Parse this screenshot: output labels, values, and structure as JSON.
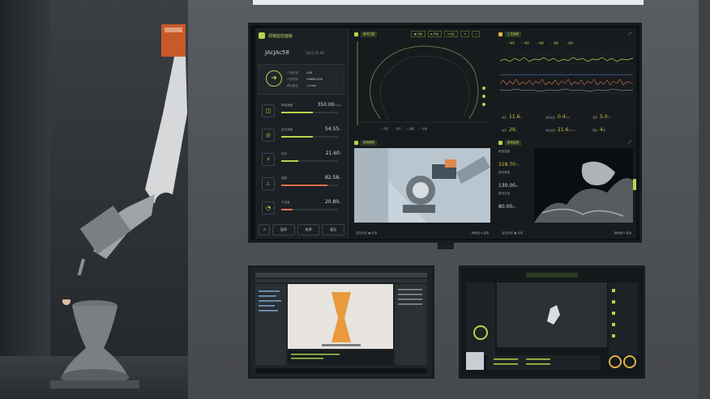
{
  "main_screen": {
    "left_panel": {
      "title": "焊接监控面板",
      "part_id": "JAcJAc58",
      "date": "2022.05.06",
      "info": [
        {
          "label": "产品型号",
          "value": "LH8"
        },
        {
          "label": "产品材料",
          "value": "H08Mn2SiA"
        },
        {
          "label": "焊丝直径",
          "value": "1.2mm"
        }
      ],
      "metrics": [
        {
          "label": "焊接速度",
          "value": "350.00",
          "unit": "mm/s",
          "fill": 0.55,
          "color": "#b8d24a"
        },
        {
          "label": "送丝速度",
          "value": "54.55",
          "unit": "%",
          "fill": 0.55,
          "color": "#b8d24a"
        },
        {
          "label": "电流",
          "value": "21.60",
          "unit": "A",
          "fill": 0.3,
          "color": "#b8d24a"
        },
        {
          "label": "温度",
          "value": "82.58",
          "unit": "%",
          "fill": 0.82,
          "color": "#e0704a"
        },
        {
          "label": "气流量",
          "value": "20.80",
          "unit": "%",
          "fill": 0.2,
          "color": "#e0704a"
        }
      ],
      "buttons": [
        "↺",
        "暂停",
        "急停",
        "复位"
      ]
    },
    "scan_panel": {
      "title": "激光扫描",
      "buttons": [
        "● 扫描",
        "▶ 开始",
        "⊗ 停止"
      ],
      "legend": [
        "— 轮廓",
        "— 层高",
        "— 偏差",
        "— 基准"
      ]
    },
    "process_panel": {
      "title": "工艺曲线",
      "legend": [
        "— 电流",
        "— 电压",
        "— 速度",
        "— 温度",
        "— 送丝"
      ],
      "stats": [
        {
          "label": "电压",
          "value": "11.6",
          "unit": "V"
        },
        {
          "label": "送丝速度",
          "value": "0.4",
          "unit": "m/s"
        },
        {
          "label": "温度",
          "value": "5.0",
          "unit": "°C"
        },
        {
          "label": "电流",
          "value": "29",
          "unit": "A"
        },
        {
          "label": "焊接速度",
          "value": "21.6",
          "unit": "mm/s"
        },
        {
          "label": "层数",
          "value": "4",
          "unit": "层"
        }
      ]
    },
    "video_panel": {
      "title": "现场视频",
      "footer_left": "监控状态 ● 在线",
      "footer_right": "清晰度 ▾ 高清"
    },
    "thermal_panel": {
      "title": "熔池监测",
      "values": [
        {
          "label": "熔池温度",
          "value": "318.70",
          "unit": "°C"
        },
        {
          "label": "熔池宽度",
          "value": "130.00",
          "unit": "m"
        },
        {
          "label": "熔池长度",
          "value": "80.00",
          "unit": "m"
        }
      ],
      "footer_left": "监控状态 ● 在线",
      "footer_right": "清晰度 ▾ 高清"
    }
  },
  "colors": {
    "accent": "#b8d24a",
    "warn": "#e0704a",
    "value_yellow": "#d9c043"
  }
}
